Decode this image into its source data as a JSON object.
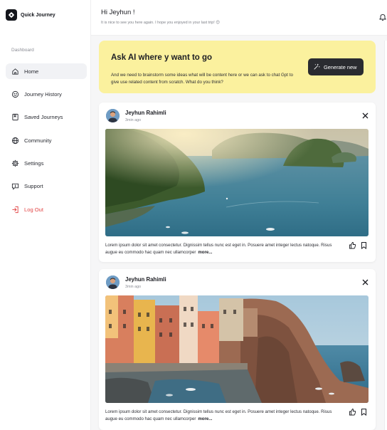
{
  "app": {
    "name": "Quick Journey"
  },
  "sidebar": {
    "section_label": "Dashboard",
    "items": [
      {
        "label": "Home",
        "icon": "home-icon",
        "active": true
      },
      {
        "label": "Journey History",
        "icon": "history-icon"
      },
      {
        "label": "Saved Journeys",
        "icon": "bookmark-icon"
      },
      {
        "label": "Community",
        "icon": "globe-icon"
      },
      {
        "label": "Settings",
        "icon": "gear-icon"
      },
      {
        "label": "Support",
        "icon": "chat-icon"
      },
      {
        "label": "Log Out",
        "icon": "logout-icon",
        "color": "#e24545"
      }
    ]
  },
  "header": {
    "greeting": "Hi Jeyhun !",
    "subtitle": "It is nice to see you here again. I hope you enjoyed in your last trip! 😊"
  },
  "ai_card": {
    "title": "Ask AI where y want to go",
    "description": "And we need to brainstorm some ideas what will be content here or we can ask to chat Gpt to give use related content from scratch. What do you think?",
    "button_label": "Generate new",
    "background": "#fbf19e"
  },
  "posts": [
    {
      "author": "Jeyhun Rahimli",
      "time": "3min ago",
      "caption": "Lorem ipsum dolor sit amet consectetur. Dignissim tellus nunc est eget in. Posuere amet integer lectus natoque. Risus augue eu commodo hac quam nec ullamcorper",
      "more": "more...",
      "image": "coastal-islands-photo"
    },
    {
      "author": "Jeyhun Rahimli",
      "time": "3min ago",
      "caption": "Lorem ipsum dolor sit amet consectetur. Dignissim tellus nunc est eget in. Posuere amet integer lectus natoque. Risus augue eu commodo hac quam nec ullamcorper",
      "more": "more...",
      "image": "cliffside-village-photo"
    }
  ]
}
